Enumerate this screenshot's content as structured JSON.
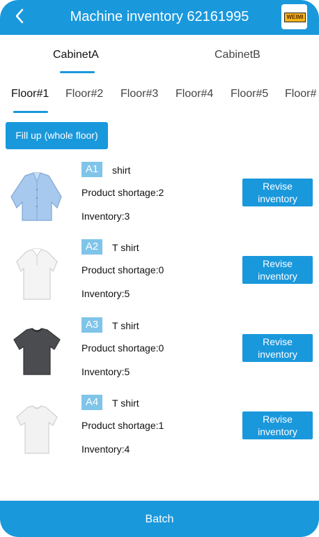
{
  "header": {
    "title": "Machine inventory 62161995",
    "back_icon": "chevron-left-icon",
    "logo_text": "WEIMI"
  },
  "cabinet_tabs": [
    {
      "label": "CabinetA",
      "active": true
    },
    {
      "label": "CabinetB",
      "active": false
    }
  ],
  "floor_tabs": [
    {
      "label": "Floor#1",
      "active": true
    },
    {
      "label": "Floor#2",
      "active": false
    },
    {
      "label": "Floor#3",
      "active": false
    },
    {
      "label": "Floor#4",
      "active": false
    },
    {
      "label": "Floor#5",
      "active": false
    },
    {
      "label": "Floor#",
      "active": false
    }
  ],
  "fill_up_label": "Fill up (whole floor)",
  "items": [
    {
      "slot": "A1",
      "name": "shirt",
      "shortage": "Product shortage:2",
      "inventory": "Inventory:3",
      "revise_label": "Revise inventory",
      "image": "blue-dress-shirt"
    },
    {
      "slot": "A2",
      "name": "T shirt",
      "shortage": "Product shortage:0",
      "inventory": "Inventory:5",
      "revise_label": "Revise inventory",
      "image": "white-polo-shirt"
    },
    {
      "slot": "A3",
      "name": "T shirt",
      "shortage": "Product shortage:0",
      "inventory": "Inventory:5",
      "revise_label": "Revise inventory",
      "image": "dark-gray-tshirt"
    },
    {
      "slot": "A4",
      "name": "T shirt",
      "shortage": "Product shortage:1",
      "inventory": "Inventory:4",
      "revise_label": "Revise inventory",
      "image": "white-tshirt"
    }
  ],
  "batch_label": "Batch",
  "colors": {
    "accent": "#1a98dc",
    "slot_badge": "#7fc4e9",
    "dark_tshirt": "#4a4c50",
    "blue_shirt": "#a8c9ee"
  }
}
